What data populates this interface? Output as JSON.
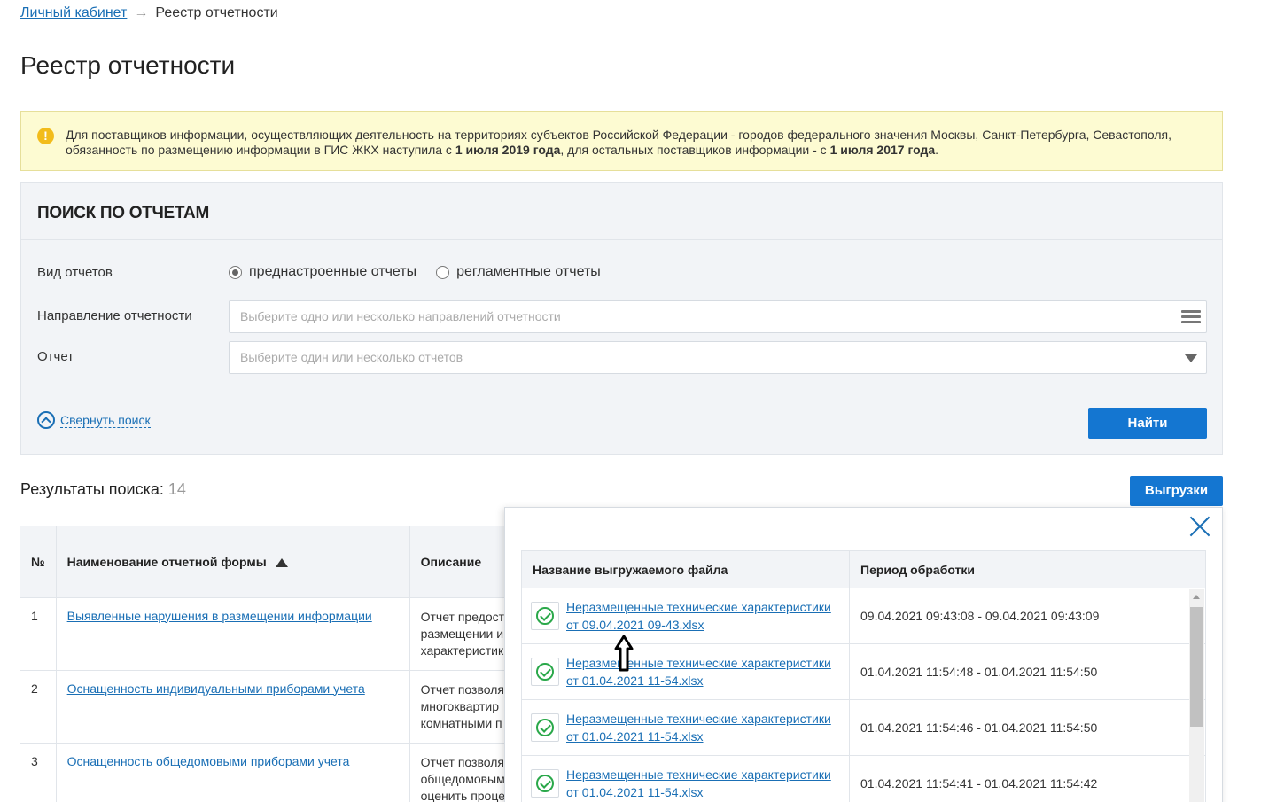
{
  "breadcrumb": {
    "home": "Личный кабинет",
    "separator": "→",
    "current": "Реестр отчетности"
  },
  "page_title": "Реестр отчетности",
  "notice": {
    "icon": "warning-icon",
    "text_1": "Для поставщиков информации, осуществляющих деятельность на территориях субъектов Российской Федерации - городов федерального значения Москвы, Санкт-Петербурга, Севастополя, обязанность по размещению информации в ГИС ЖКХ наступила с ",
    "bold_1": "1 июля 2019 года",
    "text_2": ", для остальных поставщиков информации - с ",
    "bold_2": "1 июля 2017 года",
    "text_3": "."
  },
  "search": {
    "title": "ПОИСК ПО ОТЧЕТАМ",
    "report_type_label": "Вид отчетов",
    "radio_preset": "преднастроенные отчеты",
    "radio_regulated": "регламентные отчеты",
    "selected_radio": "preset",
    "direction_label": "Направление отчетности",
    "direction_placeholder": "Выберите одно или несколько направлений отчетности",
    "report_label": "Отчет",
    "report_placeholder": "Выберите один или несколько отчетов",
    "collapse_label": "Свернуть поиск",
    "find_button": "Найти"
  },
  "results": {
    "label": "Результаты поиска:",
    "count": "14",
    "exports_button": "Выгрузки",
    "columns": {
      "num": "№",
      "name": "Наименование отчетной формы",
      "desc": "Описание"
    },
    "rows": [
      {
        "num": "1",
        "name": "Выявленные нарушения в размещении информации",
        "desc_1": "Отчет предост",
        "desc_2": "размещении и",
        "desc_3": "характеристик"
      },
      {
        "num": "2",
        "name": "Оснащенность индивидуальными приборами учета",
        "desc_1": "Отчет позволя",
        "desc_2": "многоквартир",
        "desc_3": "комнатными п"
      },
      {
        "num": "3",
        "name": "Оснащенность общедомовыми приборами учета",
        "desc_1": "Отчет позволя",
        "desc_2": "общедомовым",
        "desc_3": "оценить проце"
      }
    ]
  },
  "exports_popup": {
    "col_file": "Название выгружаемого файла",
    "col_period": "Период обработки",
    "rows": [
      {
        "file_1": "Неразмещенные технические характеристики",
        "file_2": "от 09.04.2021 09-43.xlsx",
        "period": "09.04.2021 09:43:08 - 09.04.2021 09:43:09"
      },
      {
        "file_1": "Неразмещенные технические характеристики",
        "file_2": "от 01.04.2021 11-54.xlsx",
        "period": "01.04.2021 11:54:48 - 01.04.2021 11:54:50"
      },
      {
        "file_1": "Неразмещенные технические характеристики",
        "file_2": "от 01.04.2021 11-54.xlsx",
        "period": "01.04.2021 11:54:46 - 01.04.2021 11:54:50"
      },
      {
        "file_1": "Неразмещенные технические характеристики",
        "file_2": "от 01.04.2021 11-54.xlsx",
        "period": "01.04.2021 11:54:41 - 01.04.2021 11:54:42"
      }
    ]
  },
  "colors": {
    "accent": "#1476d1",
    "link": "#1a6fb5",
    "notice_bg": "#fdfbd2",
    "success": "#2aa84a"
  }
}
